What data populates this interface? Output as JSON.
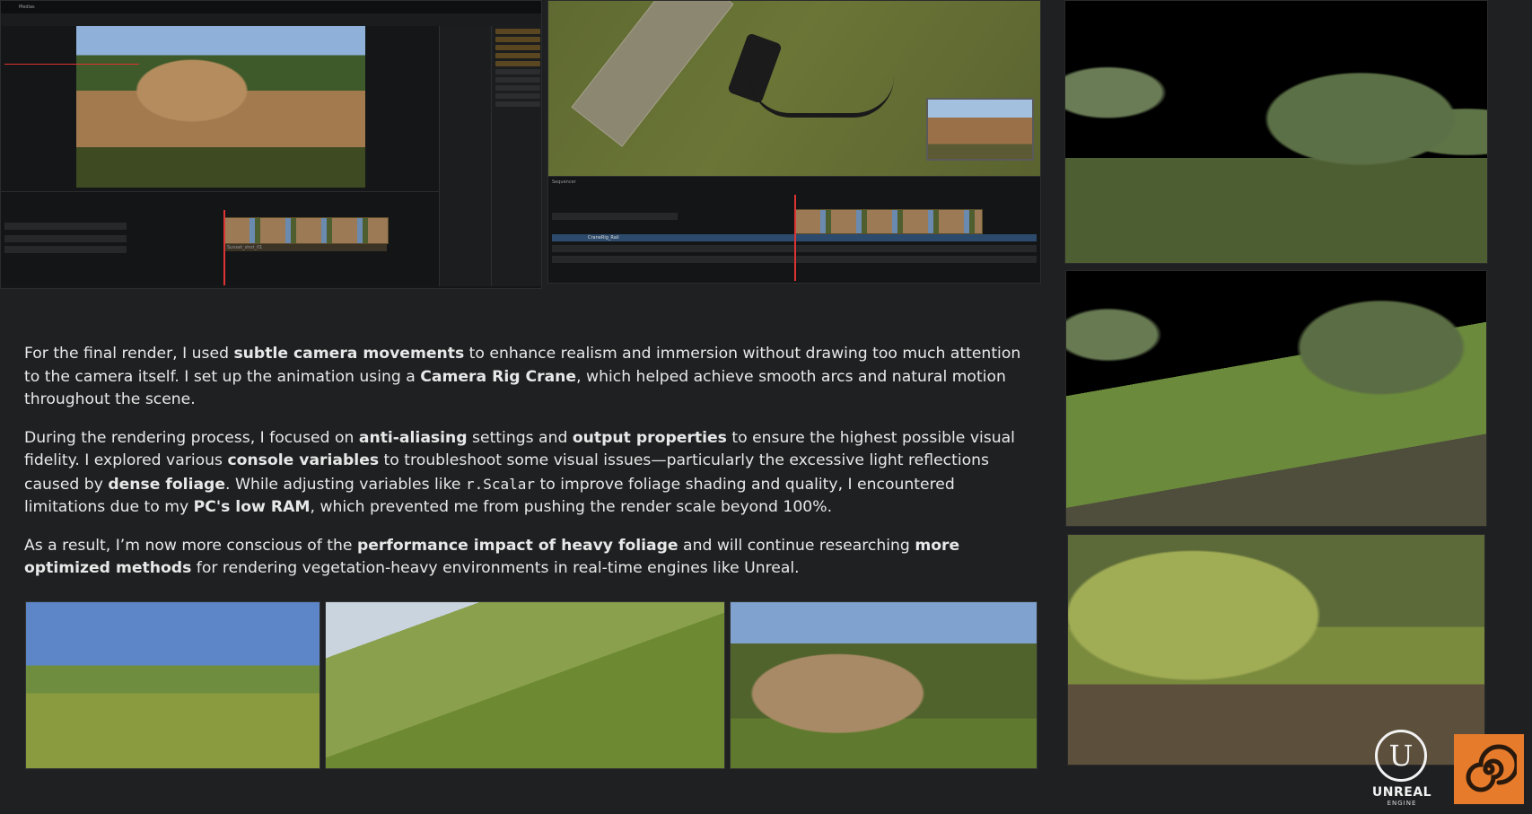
{
  "editor_left": {
    "window_title": "Medias",
    "timeline_clip_label": "Sunset_shot_01"
  },
  "editor_right": {
    "sequencer_tab": "Sequencer",
    "shot_label": "CraneRig_Rail"
  },
  "article": {
    "p1": {
      "t1": "For the final render, I used ",
      "b1": "subtle camera movements",
      "t2": " to enhance realism and immersion without drawing too much attention to the camera itself. I set up the animation using a ",
      "b2": "Camera Rig Crane",
      "t3": ", which helped achieve smooth arcs and natural motion throughout the scene."
    },
    "p2": {
      "t1": "During the rendering process, I focused on ",
      "b1": "anti-aliasing",
      "t2": " settings and ",
      "b2": "output properties",
      "t3": " to ensure the highest possible visual fidelity. I explored various ",
      "b3": "console variables",
      "t4": " to troubleshoot some visual issues—particularly the excessive light reflections caused by ",
      "b4": "dense foliage",
      "t5": ". While adjusting variables like ",
      "code": "r.Scalar",
      "t6": " to improve foliage shading and quality, I encountered limitations due to my ",
      "b5": "PC's low RAM",
      "t7": ", which prevented me from pushing the render scale beyond 100%."
    },
    "p3": {
      "t1": "As a result, I’m now more conscious of the ",
      "b1": "performance impact of heavy foliage",
      "t2": " and will continue researching ",
      "b2": "more optimized methods",
      "t3": " for rendering vegetation-heavy environments in real-time engines like Unreal."
    }
  },
  "logos": {
    "unreal_word": "UNREAL",
    "unreal_sub": "ENGINE",
    "unreal_glyph": "U",
    "houdini_glyph": "spiral-icon"
  },
  "colors": {
    "background": "#1f2021",
    "houdini_orange": "#e77b2c",
    "text": "#e8e8e8"
  }
}
